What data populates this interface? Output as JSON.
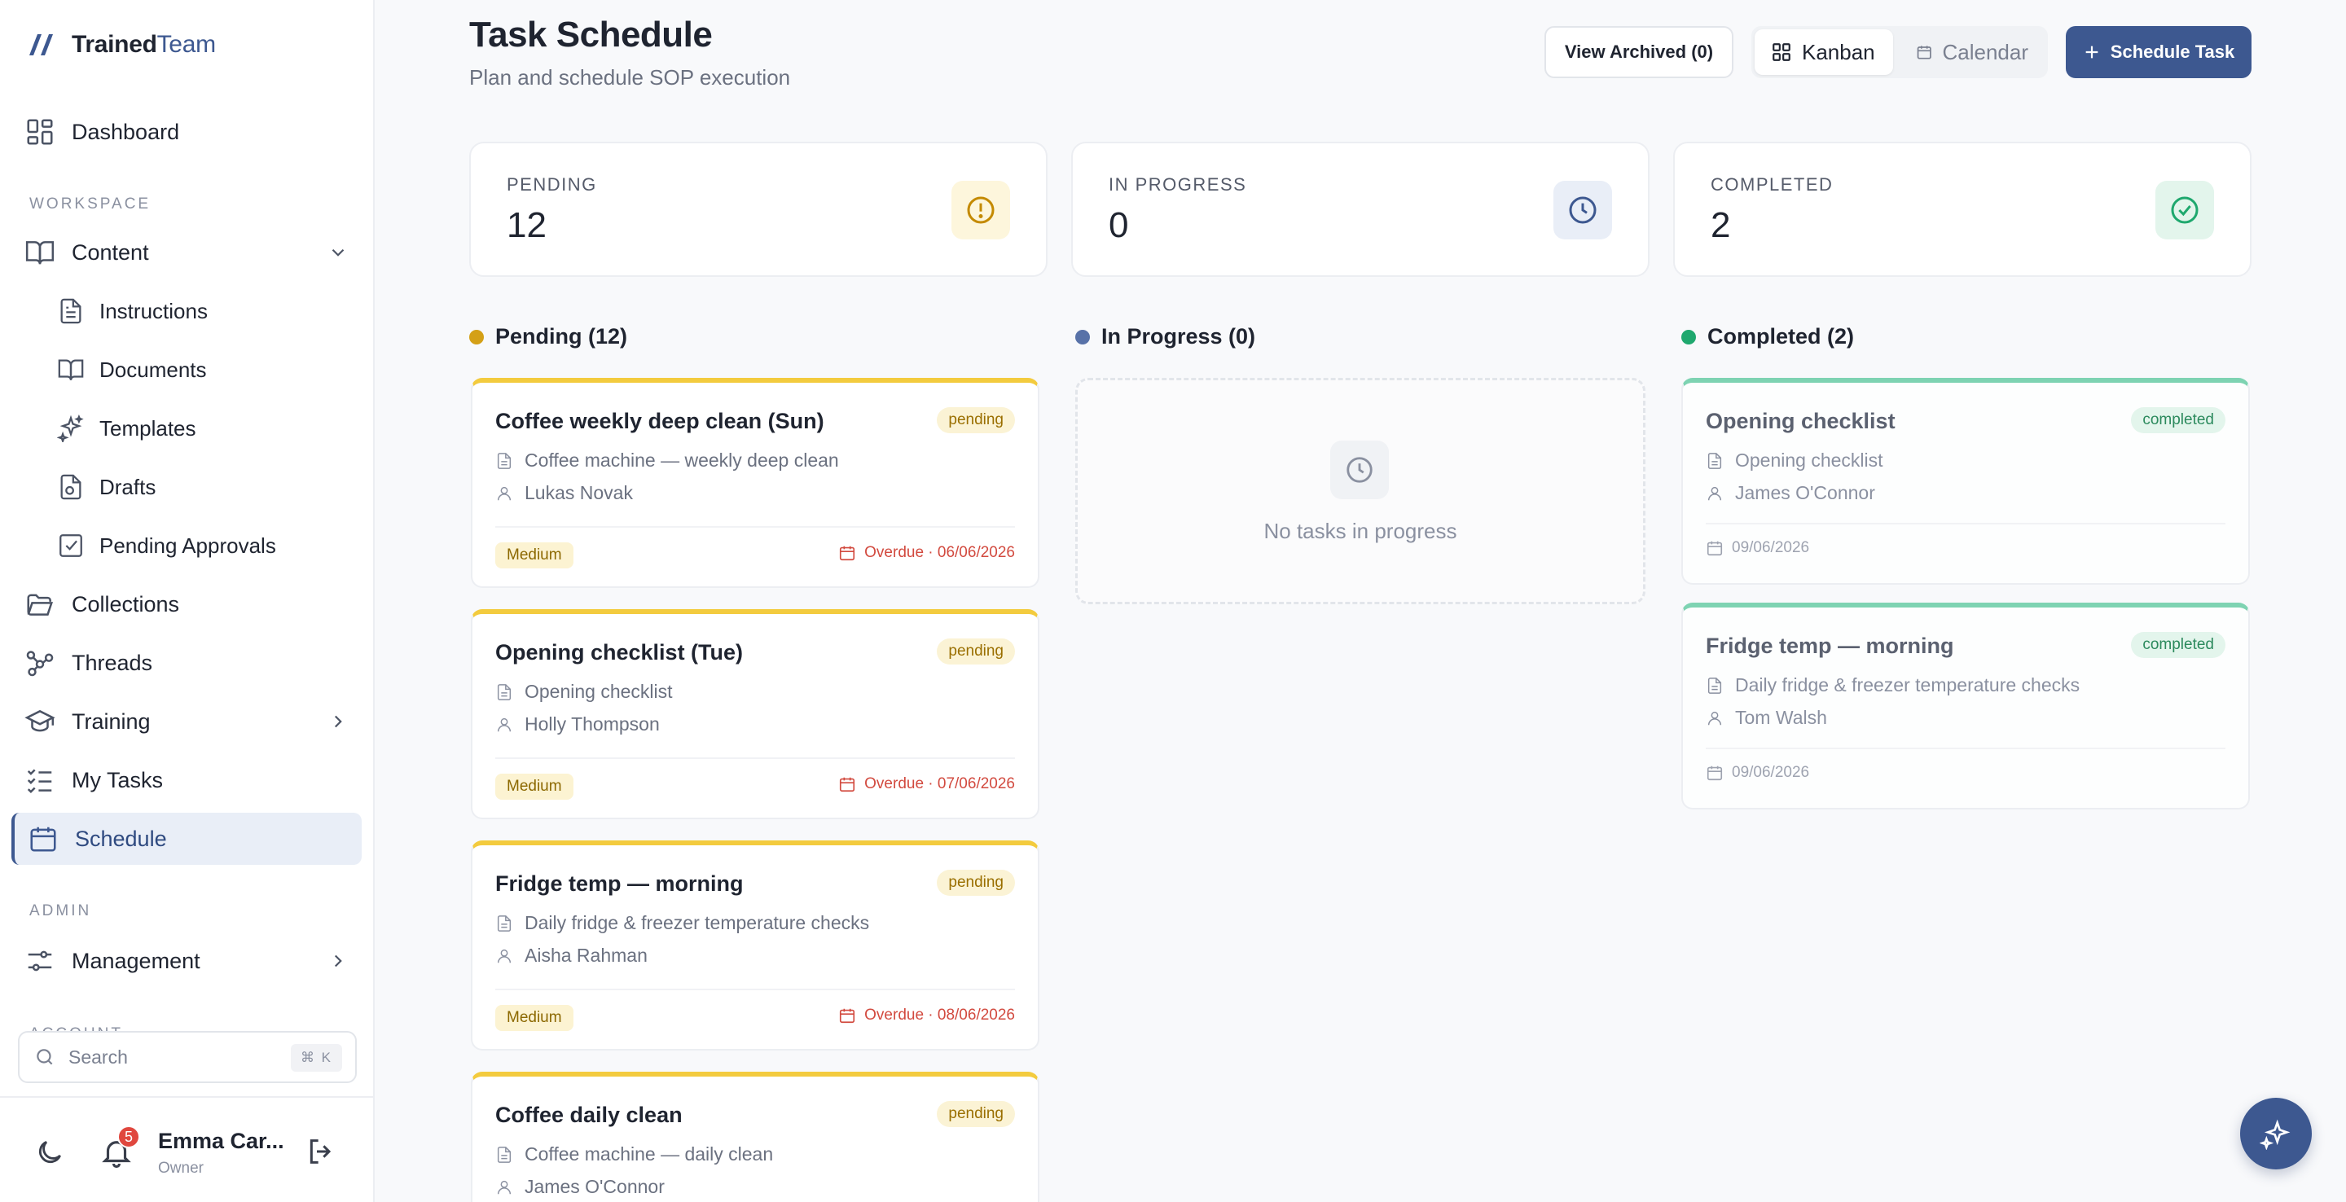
{
  "app": {
    "name_part1": "Trained",
    "name_part2": "Team"
  },
  "sidebar": {
    "dashboard": "Dashboard",
    "workspace_label": "WORKSPACE",
    "content": "Content",
    "content_items": [
      "Instructions",
      "Documents",
      "Templates",
      "Drafts",
      "Pending Approvals"
    ],
    "collections": "Collections",
    "threads": "Threads",
    "training": "Training",
    "my_tasks": "My Tasks",
    "schedule": "Schedule",
    "admin_label": "ADMIN",
    "management": "Management",
    "account_label": "ACCOUNT",
    "search_placeholder": "Search",
    "search_shortcut": "⌘ K",
    "notifications_count": "5",
    "user_name": "Emma Car...",
    "user_role": "Owner"
  },
  "header": {
    "title": "Task Schedule",
    "subtitle": "Plan and schedule SOP execution",
    "archived_button": "View Archived (0)",
    "view_kanban": "Kanban",
    "view_calendar": "Calendar",
    "schedule_button": "Schedule Task"
  },
  "stats": {
    "pending": {
      "label": "PENDING",
      "value": "12"
    },
    "in_progress": {
      "label": "IN PROGRESS",
      "value": "0"
    },
    "completed": {
      "label": "COMPLETED",
      "value": "2"
    }
  },
  "columns": {
    "pending": {
      "title": "Pending (12)",
      "tasks": [
        {
          "title": "Coffee weekly deep clean (Sun)",
          "status": "pending",
          "sop": "Coffee machine — weekly deep clean",
          "assignee": "Lukas Novak",
          "priority": "Medium",
          "due": "Overdue · 06/06/2026"
        },
        {
          "title": "Opening checklist (Tue)",
          "status": "pending",
          "sop": "Opening checklist",
          "assignee": "Holly Thompson",
          "priority": "Medium",
          "due": "Overdue · 07/06/2026"
        },
        {
          "title": "Fridge temp — morning",
          "status": "pending",
          "sop": "Daily fridge & freezer temperature checks",
          "assignee": "Aisha Rahman",
          "priority": "Medium",
          "due": "Overdue · 08/06/2026"
        },
        {
          "title": "Coffee daily clean",
          "status": "pending",
          "sop": "Coffee machine — daily clean",
          "assignee": "James O'Connor"
        }
      ]
    },
    "in_progress": {
      "title": "In Progress (0)",
      "empty_text": "No tasks in progress"
    },
    "completed": {
      "title": "Completed (2)",
      "tasks": [
        {
          "title": "Opening checklist",
          "status": "completed",
          "sop": "Opening checklist",
          "assignee": "James O'Connor",
          "due": "09/06/2026"
        },
        {
          "title": "Fridge temp — morning",
          "status": "completed",
          "sop": "Daily fridge & freezer temperature checks",
          "assignee": "Tom Walsh",
          "due": "09/06/2026"
        }
      ]
    }
  },
  "colors": {
    "brand": "#3d5890",
    "pending": "#d4a017",
    "in_progress": "#5872a8",
    "completed": "#1fa86e",
    "overdue": "#d24a3f"
  }
}
